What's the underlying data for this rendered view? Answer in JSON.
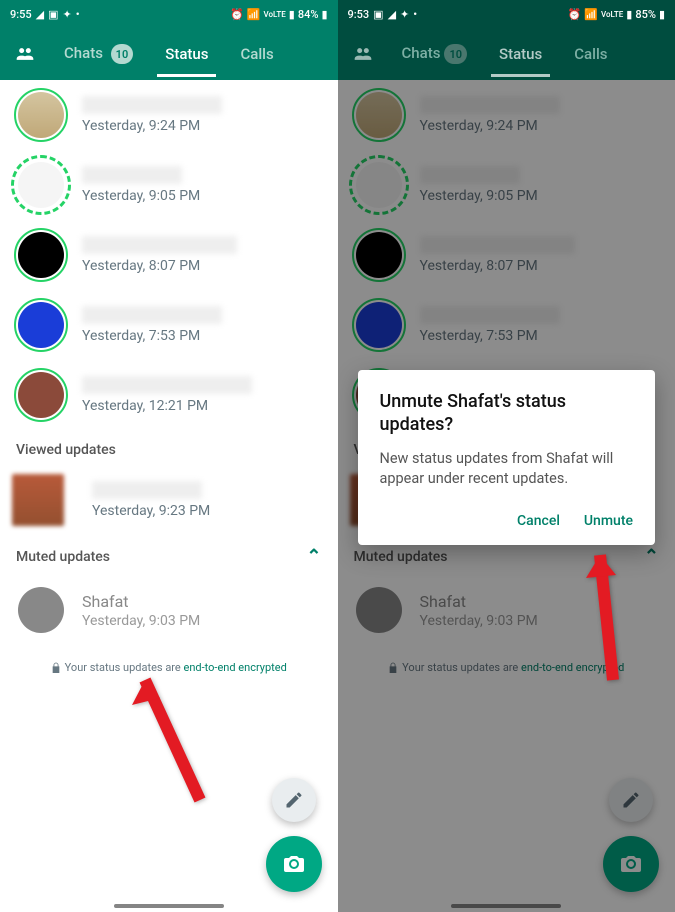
{
  "left": {
    "time": "9:55",
    "battery": "84%",
    "tabs": {
      "chats": "Chats",
      "chats_badge": "10",
      "status": "Status",
      "calls": "Calls"
    },
    "statuses": [
      {
        "time": "Yesterday, 9:24 PM",
        "avatar": "bag",
        "ring": "green"
      },
      {
        "time": "Yesterday, 9:05 PM",
        "avatar": "text",
        "ring": "dashed"
      },
      {
        "time": "Yesterday, 8:07 PM",
        "avatar": "black",
        "ring": "green"
      },
      {
        "time": "Yesterday, 7:53 PM",
        "avatar": "blue",
        "ring": "green"
      },
      {
        "time": "Yesterday, 12:21 PM",
        "avatar": "brown",
        "ring": "green"
      }
    ],
    "viewed_header": "Viewed updates",
    "viewed": {
      "time": "Yesterday, 9:23 PM"
    },
    "muted_header": "Muted updates",
    "muted": {
      "name": "Shafat",
      "time": "Yesterday, 9:03 PM"
    },
    "encrypted_pre": "Your status updates are ",
    "encrypted_link": "end-to-end encrypted"
  },
  "right": {
    "time": "9:53",
    "battery": "85%",
    "dialog": {
      "title": "Unmute Shafat's status updates?",
      "body": "New status updates from Shafat will appear under recent updates.",
      "cancel": "Cancel",
      "unmute": "Unmute"
    }
  }
}
